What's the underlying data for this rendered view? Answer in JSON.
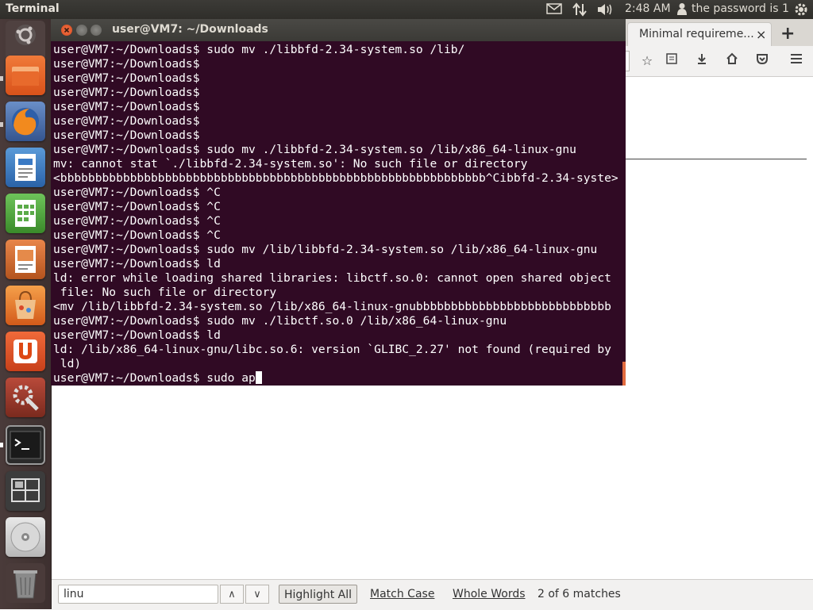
{
  "top_panel": {
    "app_title": "Terminal",
    "mail_icon": "mail-icon",
    "network_icon": "network-arrows-icon",
    "sound_icon": "speaker-icon",
    "time": "2:48 AM",
    "user_icon": "user-icon",
    "user_text": "the password is 1"
  },
  "launcher": {
    "items": [
      "dash-home-icon",
      "files-icon",
      "firefox-icon",
      "writer-icon",
      "calc-icon",
      "impress-icon",
      "software-center-icon",
      "ubuntu-one-icon",
      "system-settings-icon",
      "terminal-icon",
      "workspace-switcher-icon",
      "dvd-icon",
      "trash-icon"
    ]
  },
  "terminal": {
    "title": "user@VM7: ~/Downloads",
    "lines": [
      "user@VM7:~/Downloads$ sudo mv ./libbfd-2.34-system.so /lib/",
      "user@VM7:~/Downloads$",
      "user@VM7:~/Downloads$",
      "user@VM7:~/Downloads$",
      "user@VM7:~/Downloads$",
      "user@VM7:~/Downloads$",
      "user@VM7:~/Downloads$",
      "user@VM7:~/Downloads$ sudo mv ./libbfd-2.34-system.so /lib/x86_64-linux-gnu",
      "mv: cannot stat `./libbfd-2.34-system.so': No such file or directory",
      "<bbbbbbbbbbbbbbbbbbbbbbbbbbbbbbbbbbbbbbbbbbbbbbbbbbbbbbbbbbbbb^Cibbfd-2.34-syste>",
      "user@VM7:~/Downloads$ ^C",
      "user@VM7:~/Downloads$ ^C",
      "user@VM7:~/Downloads$ ^C",
      "user@VM7:~/Downloads$ ^C",
      "user@VM7:~/Downloads$ sudo mv /lib/libbfd-2.34-system.so /lib/x86_64-linux-gnu",
      "user@VM7:~/Downloads$ ld",
      "ld: error while loading shared libraries: libctf.so.0: cannot open shared object",
      " file: No such file or directory",
      "<mv /lib/libbfd-2.34-system.so /lib/x86_64-linux-gnubbbbbbbbbbbbbbbbbbbbbbbbbbbb",
      "user@VM7:~/Downloads$ sudo mv ./libctf.so.0 /lib/x86_64-linux-gnu",
      "user@VM7:~/Downloads$ ld",
      "ld: /lib/x86_64-linux-gnu/libc.so.6: version `GLIBC_2.27' not found (required by",
      " ld)"
    ],
    "current_prompt": "user@VM7:~/Downloads$ sudo ap"
  },
  "firefox": {
    "tab_title": "Minimal requireme...",
    "tab_close": "×",
    "new_tab": "+"
  },
  "findbar": {
    "query": "linu",
    "prev_label": "∧",
    "next_label": "∨",
    "highlight_all": "Highlight All",
    "match_case": "Match Case",
    "whole_words": "Whole Words",
    "status": "2 of 6 matches"
  }
}
